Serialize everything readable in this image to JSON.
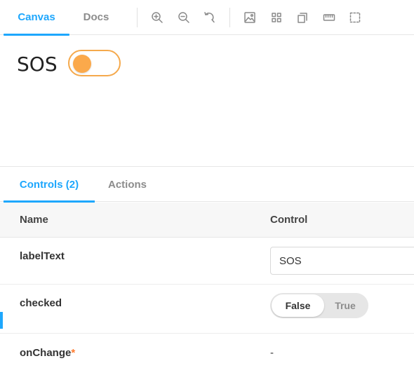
{
  "toolbar": {
    "tabs": [
      {
        "label": "Canvas",
        "active": true
      },
      {
        "label": "Docs",
        "active": false
      }
    ],
    "tools": [
      "zoom-in-icon",
      "zoom-out-icon",
      "reset-zoom-icon",
      "background-icon",
      "grid-icon",
      "viewport-icon",
      "measure-icon",
      "outline-icon"
    ]
  },
  "canvas": {
    "label_text": "SOS",
    "switch_checked": true
  },
  "addons": {
    "tabs": [
      {
        "label": "Controls (2)",
        "active": true
      },
      {
        "label": "Actions",
        "active": false
      }
    ],
    "columns": {
      "name": "Name",
      "control": "Control"
    },
    "rows": [
      {
        "name": "labelText",
        "value": "SOS"
      },
      {
        "name": "checked",
        "false_label": "False",
        "true_label": "True",
        "selected": "False"
      },
      {
        "name": "onChange",
        "required_mark": "*",
        "value": "-"
      }
    ]
  },
  "colors": {
    "accent": "#1ea7fd",
    "switch": "#fba94b",
    "required": "#ff7b2e"
  }
}
